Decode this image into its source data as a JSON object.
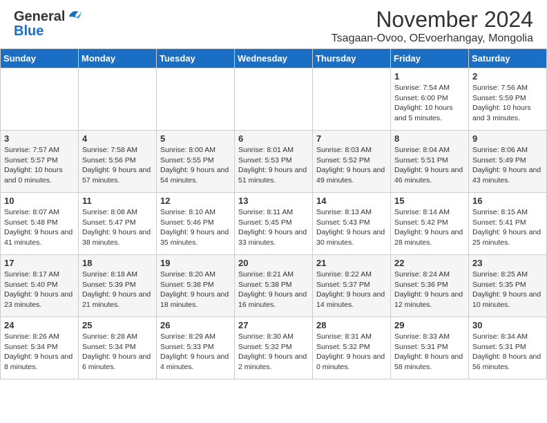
{
  "header": {
    "logo_general": "General",
    "logo_blue": "Blue",
    "month_title": "November 2024",
    "location": "Tsagaan-Ovoo, OEvoerhangay, Mongolia"
  },
  "weekdays": [
    "Sunday",
    "Monday",
    "Tuesday",
    "Wednesday",
    "Thursday",
    "Friday",
    "Saturday"
  ],
  "weeks": [
    [
      {
        "day": "",
        "sunrise": "",
        "sunset": "",
        "daylight": ""
      },
      {
        "day": "",
        "sunrise": "",
        "sunset": "",
        "daylight": ""
      },
      {
        "day": "",
        "sunrise": "",
        "sunset": "",
        "daylight": ""
      },
      {
        "day": "",
        "sunrise": "",
        "sunset": "",
        "daylight": ""
      },
      {
        "day": "",
        "sunrise": "",
        "sunset": "",
        "daylight": ""
      },
      {
        "day": "1",
        "sunrise": "Sunrise: 7:54 AM",
        "sunset": "Sunset: 6:00 PM",
        "daylight": "Daylight: 10 hours and 5 minutes."
      },
      {
        "day": "2",
        "sunrise": "Sunrise: 7:56 AM",
        "sunset": "Sunset: 5:59 PM",
        "daylight": "Daylight: 10 hours and 3 minutes."
      }
    ],
    [
      {
        "day": "3",
        "sunrise": "Sunrise: 7:57 AM",
        "sunset": "Sunset: 5:57 PM",
        "daylight": "Daylight: 10 hours and 0 minutes."
      },
      {
        "day": "4",
        "sunrise": "Sunrise: 7:58 AM",
        "sunset": "Sunset: 5:56 PM",
        "daylight": "Daylight: 9 hours and 57 minutes."
      },
      {
        "day": "5",
        "sunrise": "Sunrise: 8:00 AM",
        "sunset": "Sunset: 5:55 PM",
        "daylight": "Daylight: 9 hours and 54 minutes."
      },
      {
        "day": "6",
        "sunrise": "Sunrise: 8:01 AM",
        "sunset": "Sunset: 5:53 PM",
        "daylight": "Daylight: 9 hours and 51 minutes."
      },
      {
        "day": "7",
        "sunrise": "Sunrise: 8:03 AM",
        "sunset": "Sunset: 5:52 PM",
        "daylight": "Daylight: 9 hours and 49 minutes."
      },
      {
        "day": "8",
        "sunrise": "Sunrise: 8:04 AM",
        "sunset": "Sunset: 5:51 PM",
        "daylight": "Daylight: 9 hours and 46 minutes."
      },
      {
        "day": "9",
        "sunrise": "Sunrise: 8:06 AM",
        "sunset": "Sunset: 5:49 PM",
        "daylight": "Daylight: 9 hours and 43 minutes."
      }
    ],
    [
      {
        "day": "10",
        "sunrise": "Sunrise: 8:07 AM",
        "sunset": "Sunset: 5:48 PM",
        "daylight": "Daylight: 9 hours and 41 minutes."
      },
      {
        "day": "11",
        "sunrise": "Sunrise: 8:08 AM",
        "sunset": "Sunset: 5:47 PM",
        "daylight": "Daylight: 9 hours and 38 minutes."
      },
      {
        "day": "12",
        "sunrise": "Sunrise: 8:10 AM",
        "sunset": "Sunset: 5:46 PM",
        "daylight": "Daylight: 9 hours and 35 minutes."
      },
      {
        "day": "13",
        "sunrise": "Sunrise: 8:11 AM",
        "sunset": "Sunset: 5:45 PM",
        "daylight": "Daylight: 9 hours and 33 minutes."
      },
      {
        "day": "14",
        "sunrise": "Sunrise: 8:13 AM",
        "sunset": "Sunset: 5:43 PM",
        "daylight": "Daylight: 9 hours and 30 minutes."
      },
      {
        "day": "15",
        "sunrise": "Sunrise: 8:14 AM",
        "sunset": "Sunset: 5:42 PM",
        "daylight": "Daylight: 9 hours and 28 minutes."
      },
      {
        "day": "16",
        "sunrise": "Sunrise: 8:15 AM",
        "sunset": "Sunset: 5:41 PM",
        "daylight": "Daylight: 9 hours and 25 minutes."
      }
    ],
    [
      {
        "day": "17",
        "sunrise": "Sunrise: 8:17 AM",
        "sunset": "Sunset: 5:40 PM",
        "daylight": "Daylight: 9 hours and 23 minutes."
      },
      {
        "day": "18",
        "sunrise": "Sunrise: 8:18 AM",
        "sunset": "Sunset: 5:39 PM",
        "daylight": "Daylight: 9 hours and 21 minutes."
      },
      {
        "day": "19",
        "sunrise": "Sunrise: 8:20 AM",
        "sunset": "Sunset: 5:38 PM",
        "daylight": "Daylight: 9 hours and 18 minutes."
      },
      {
        "day": "20",
        "sunrise": "Sunrise: 8:21 AM",
        "sunset": "Sunset: 5:38 PM",
        "daylight": "Daylight: 9 hours and 16 minutes."
      },
      {
        "day": "21",
        "sunrise": "Sunrise: 8:22 AM",
        "sunset": "Sunset: 5:37 PM",
        "daylight": "Daylight: 9 hours and 14 minutes."
      },
      {
        "day": "22",
        "sunrise": "Sunrise: 8:24 AM",
        "sunset": "Sunset: 5:36 PM",
        "daylight": "Daylight: 9 hours and 12 minutes."
      },
      {
        "day": "23",
        "sunrise": "Sunrise: 8:25 AM",
        "sunset": "Sunset: 5:35 PM",
        "daylight": "Daylight: 9 hours and 10 minutes."
      }
    ],
    [
      {
        "day": "24",
        "sunrise": "Sunrise: 8:26 AM",
        "sunset": "Sunset: 5:34 PM",
        "daylight": "Daylight: 9 hours and 8 minutes."
      },
      {
        "day": "25",
        "sunrise": "Sunrise: 8:28 AM",
        "sunset": "Sunset: 5:34 PM",
        "daylight": "Daylight: 9 hours and 6 minutes."
      },
      {
        "day": "26",
        "sunrise": "Sunrise: 8:29 AM",
        "sunset": "Sunset: 5:33 PM",
        "daylight": "Daylight: 9 hours and 4 minutes."
      },
      {
        "day": "27",
        "sunrise": "Sunrise: 8:30 AM",
        "sunset": "Sunset: 5:32 PM",
        "daylight": "Daylight: 9 hours and 2 minutes."
      },
      {
        "day": "28",
        "sunrise": "Sunrise: 8:31 AM",
        "sunset": "Sunset: 5:32 PM",
        "daylight": "Daylight: 9 hours and 0 minutes."
      },
      {
        "day": "29",
        "sunrise": "Sunrise: 8:33 AM",
        "sunset": "Sunset: 5:31 PM",
        "daylight": "Daylight: 8 hours and 58 minutes."
      },
      {
        "day": "30",
        "sunrise": "Sunrise: 8:34 AM",
        "sunset": "Sunset: 5:31 PM",
        "daylight": "Daylight: 8 hours and 56 minutes."
      }
    ]
  ]
}
